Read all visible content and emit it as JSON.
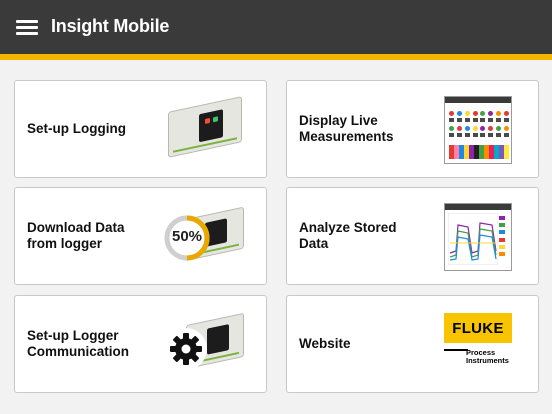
{
  "app": {
    "title": "Insight Mobile"
  },
  "colors": {
    "appbar": "#3a3a3a",
    "accent": "#f4b400",
    "tile_bg": "#ffffff",
    "fluke_yellow": "#f8c400"
  },
  "tiles": [
    {
      "label": "Set-up Logging",
      "image": "logger-device"
    },
    {
      "label": "Display Live Measurements",
      "image": "live-measurements-screen"
    },
    {
      "label": "Download Data from logger",
      "image": "logger-download-progress",
      "badge": "50%",
      "progress_percent": 50
    },
    {
      "label": "Analyze Stored Data",
      "image": "trend-chart-screen"
    },
    {
      "label": "Set-up Logger Communication",
      "image": "logger-with-gear"
    },
    {
      "label": "Website",
      "image": "fluke-logo",
      "logo": {
        "brand": "FLUKE",
        "line1": "Process",
        "line2": "Instruments"
      }
    }
  ]
}
